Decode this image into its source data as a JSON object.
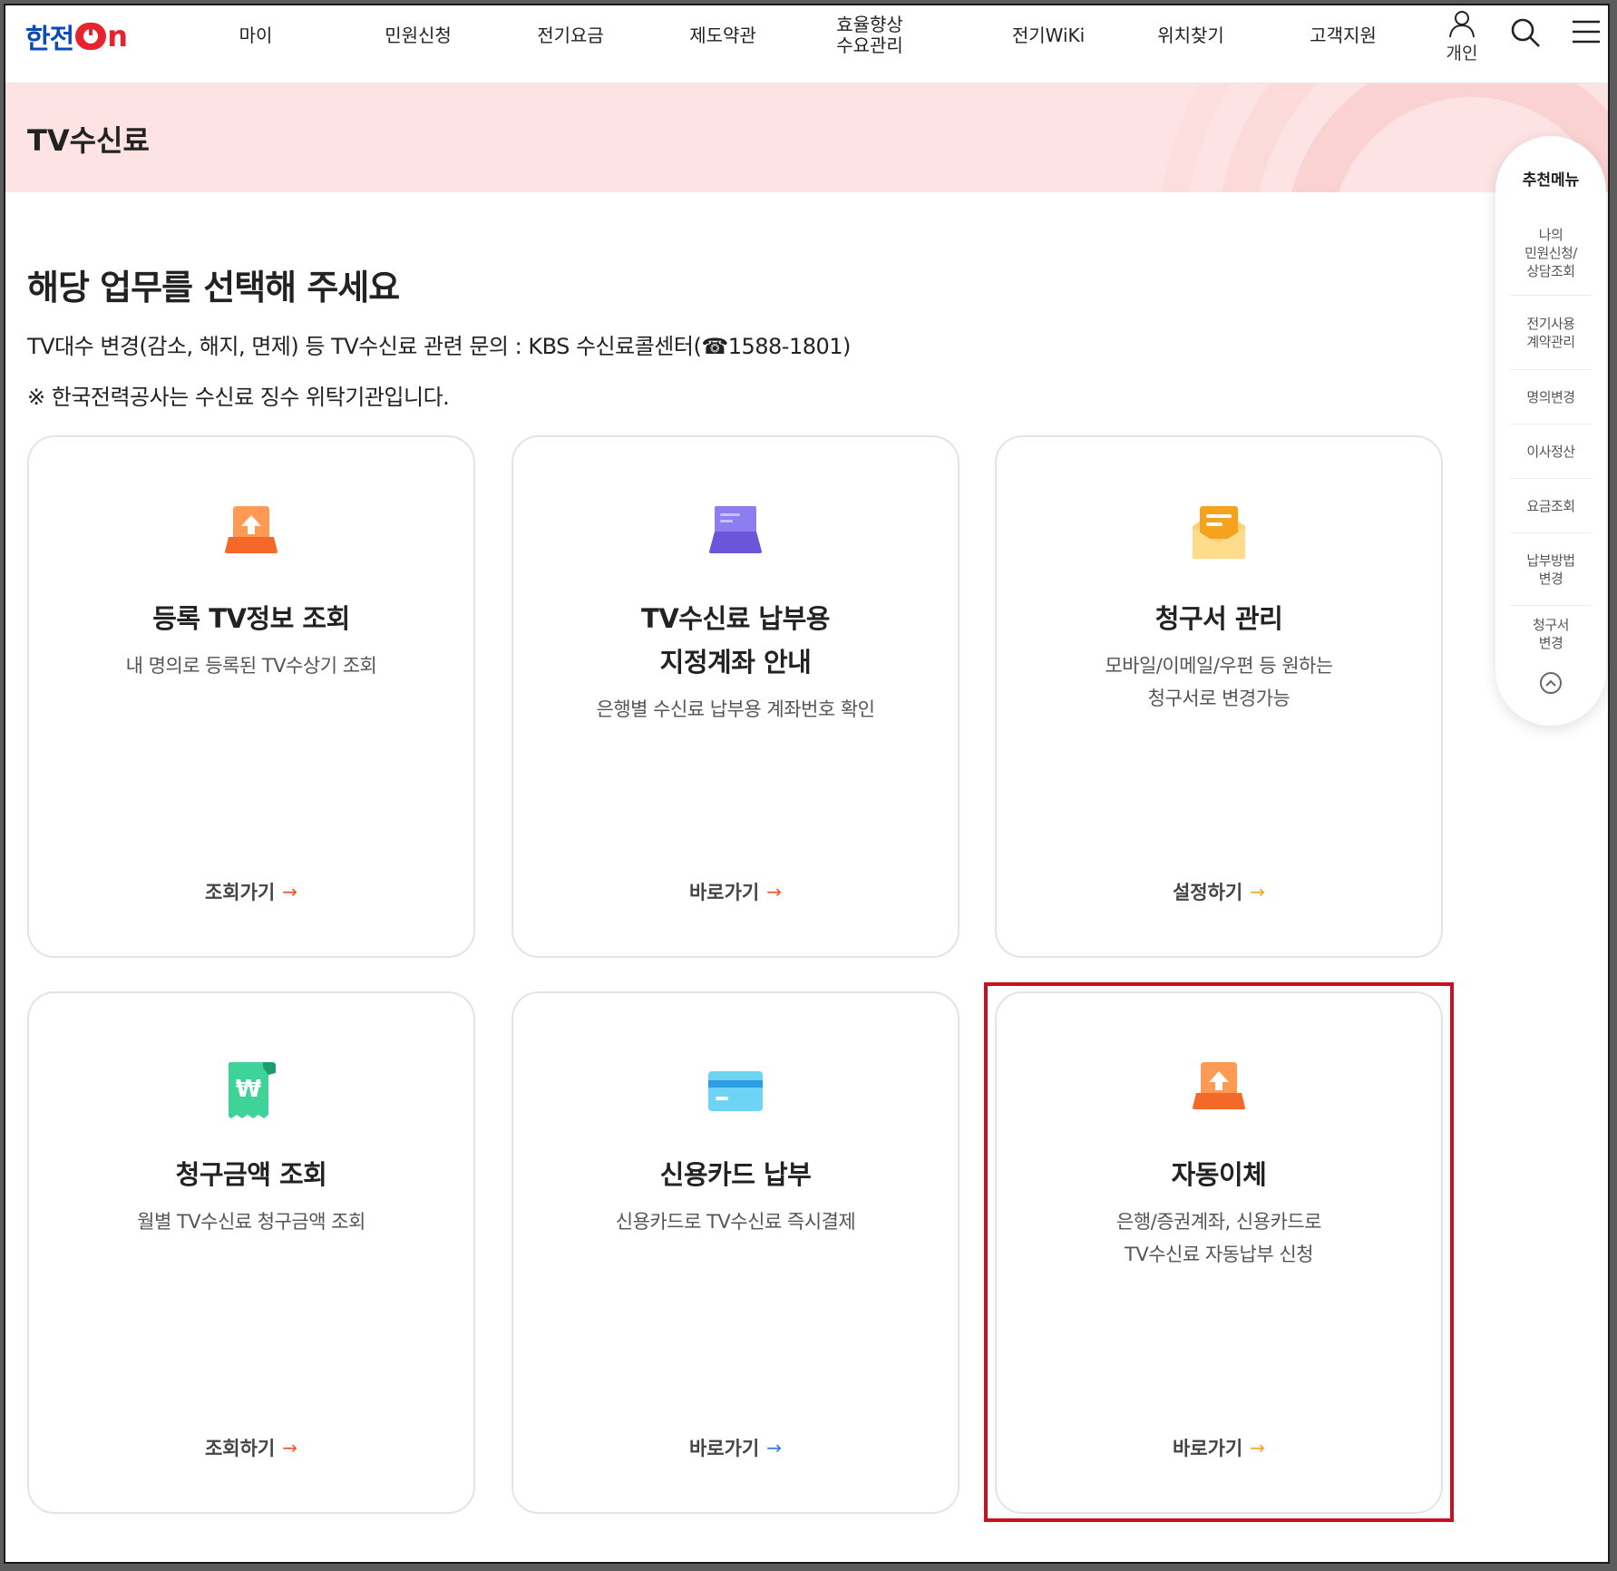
{
  "header": {
    "logo_main": "한전",
    "logo_on": "on",
    "nav": [
      {
        "label": "마이"
      },
      {
        "label": "민원신청"
      },
      {
        "label": "전기요금"
      },
      {
        "label": "제도약관"
      },
      {
        "line1": "효율향상",
        "line2": "수요관리"
      },
      {
        "label": "전기WiKi"
      },
      {
        "label": "위치찾기"
      },
      {
        "label": "고객지원"
      }
    ],
    "user_label": "개인",
    "icons": {
      "user": "user-icon",
      "search": "search-icon",
      "menu": "hamburger-menu-icon"
    }
  },
  "banner": {
    "title": "TV수신료",
    "bg_color": "#fde3e3"
  },
  "main": {
    "headline": "해당 업무를 선택해 주세요",
    "desc1": "TV대수 변경(감소, 해지, 면제) 등 TV수신료 관련 문의 : KBS 수신료콜센터(☎1588-1801)",
    "desc2": "※ 한국전력공사는 수신료 징수 위탁기관입니다."
  },
  "cards": [
    {
      "title": "등록 TV정보 조회",
      "sub1": "내 명의로 등록된 TV수상기 조회",
      "link": "조회가기",
      "icon": "tv-upload-icon",
      "arrow_color": "#f0552a"
    },
    {
      "title1": "TV수신료 납부용",
      "title2": "지정계좌 안내",
      "sub1": "은행별 수신료 납부용 계좌번호 확인",
      "link": "바로가기",
      "icon": "bank-account-icon",
      "arrow_color": "#f0552a"
    },
    {
      "title": "청구서 관리",
      "sub1": "모바일/이메일/우편 등 원하는",
      "sub2": "청구서로 변경가능",
      "link": "설정하기",
      "icon": "envelope-icon",
      "arrow_color": "#f5a623"
    },
    {
      "title": "청구금액 조회",
      "sub1": "월별 TV수신료 청구금액 조회",
      "link": "조회하기",
      "icon": "won-receipt-icon",
      "arrow_color": "#f0552a"
    },
    {
      "title": "신용카드 납부",
      "sub1": "신용카드로 TV수신료 즉시결제",
      "link": "바로가기",
      "icon": "credit-card-icon",
      "arrow_color": "#2a7de1"
    },
    {
      "title": "자동이체",
      "sub1": "은행/증권계좌, 신용카드로",
      "sub2": "TV수신료 자동납부 신청",
      "link": "바로가기",
      "icon": "auto-transfer-icon",
      "arrow_color": "#f5a623"
    }
  ],
  "quick_menu": {
    "title": "추천메뉴",
    "items": [
      {
        "line1": "나의",
        "line2": "민원신청/",
        "line3": "상담조회"
      },
      {
        "line1": "전기사용",
        "line2": "계약관리"
      },
      {
        "line1": "명의변경"
      },
      {
        "line1": "이사정산"
      },
      {
        "line1": "요금조회"
      },
      {
        "line1": "납부방법",
        "line2": "변경"
      },
      {
        "line1": "청구서",
        "line2": "변경"
      }
    ],
    "top_icon": "chevron-up-circle-icon"
  },
  "colors": {
    "highlight": "#c8101e",
    "brand_blue": "#0a4bb8",
    "brand_red": "#e8232f"
  }
}
